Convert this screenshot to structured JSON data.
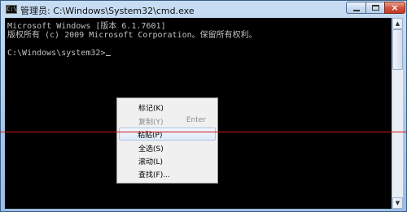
{
  "window": {
    "title": "管理员: C:\\Windows\\System32\\cmd.exe",
    "icon_label": "C:\\",
    "buttons": {
      "minimize": "minimize-icon",
      "maximize": "maximize-icon",
      "close": "×"
    }
  },
  "console": {
    "lines": [
      "Microsoft Windows [版本 6.1.7601]",
      "版权所有 (c) 2009 Microsoft Corporation。保留所有权利。",
      "",
      "C:\\Windows\\system32>"
    ]
  },
  "scrollbar": {
    "up_arrow": "▲",
    "down_arrow": "▼"
  },
  "context_menu": {
    "items": [
      {
        "label": "标记(K)",
        "shortcut": "",
        "enabled": true
      },
      {
        "label": "复制(Y)",
        "shortcut": "Enter",
        "enabled": false
      },
      {
        "label": "粘贴(P)",
        "shortcut": "",
        "enabled": true,
        "highlighted": true
      },
      {
        "label": "全选(S)",
        "shortcut": "",
        "enabled": true
      },
      {
        "label": "滚动(L)",
        "shortcut": "",
        "enabled": true
      },
      {
        "label": "查找(F)...",
        "shortcut": "",
        "enabled": true
      }
    ]
  },
  "colors": {
    "console_bg": "#000000",
    "console_text": "#C0C0C0",
    "annotation_line": "#D21818"
  }
}
